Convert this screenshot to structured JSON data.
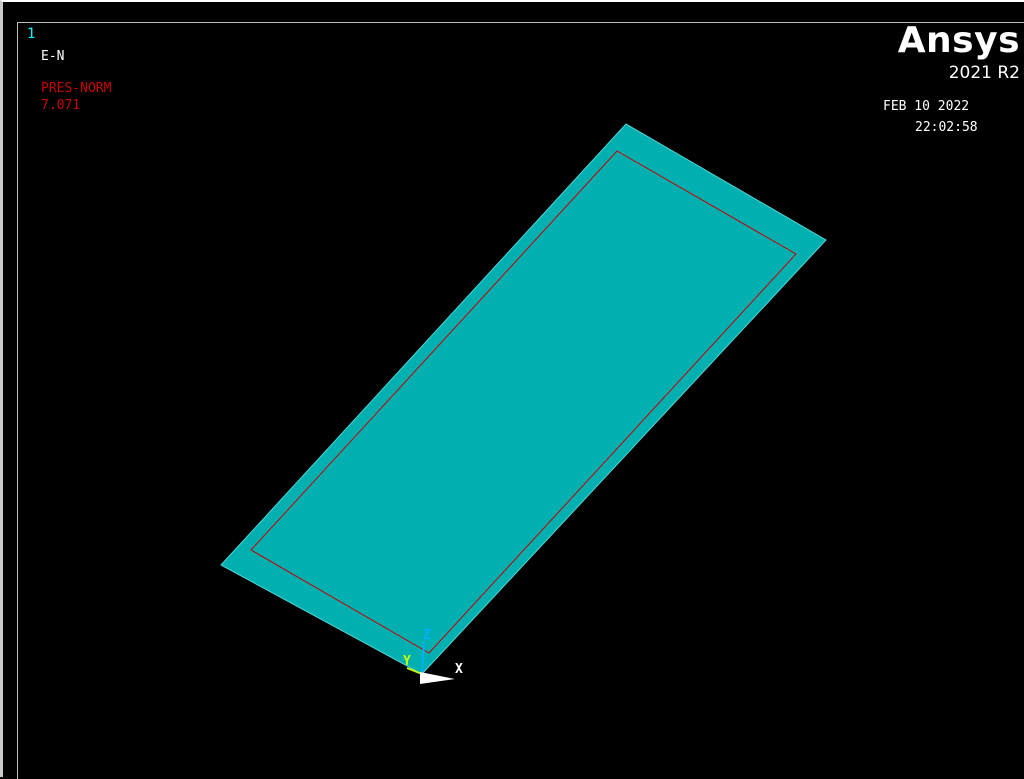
{
  "window": {
    "number": "1"
  },
  "plot": {
    "label": "E-N",
    "load_label": "PRES-NORM",
    "load_value": "7.071"
  },
  "brand": {
    "name": "Ansys",
    "version": "2021 R2"
  },
  "timestamp": {
    "date": "FEB 10 2022",
    "time": "22:02:58"
  },
  "triad": {
    "x_label": "X",
    "y_label": "Y",
    "z_label": "Z"
  },
  "colors": {
    "background": "#000000",
    "element_fill": "#00b0b0",
    "load_outline": "#c80000",
    "window_number": "#00ffff",
    "load_text": "#c80000",
    "text": "#ffffff",
    "axis_x": "#ffffff",
    "axis_y": "#c8ff00",
    "axis_z": "#00b0ff"
  }
}
